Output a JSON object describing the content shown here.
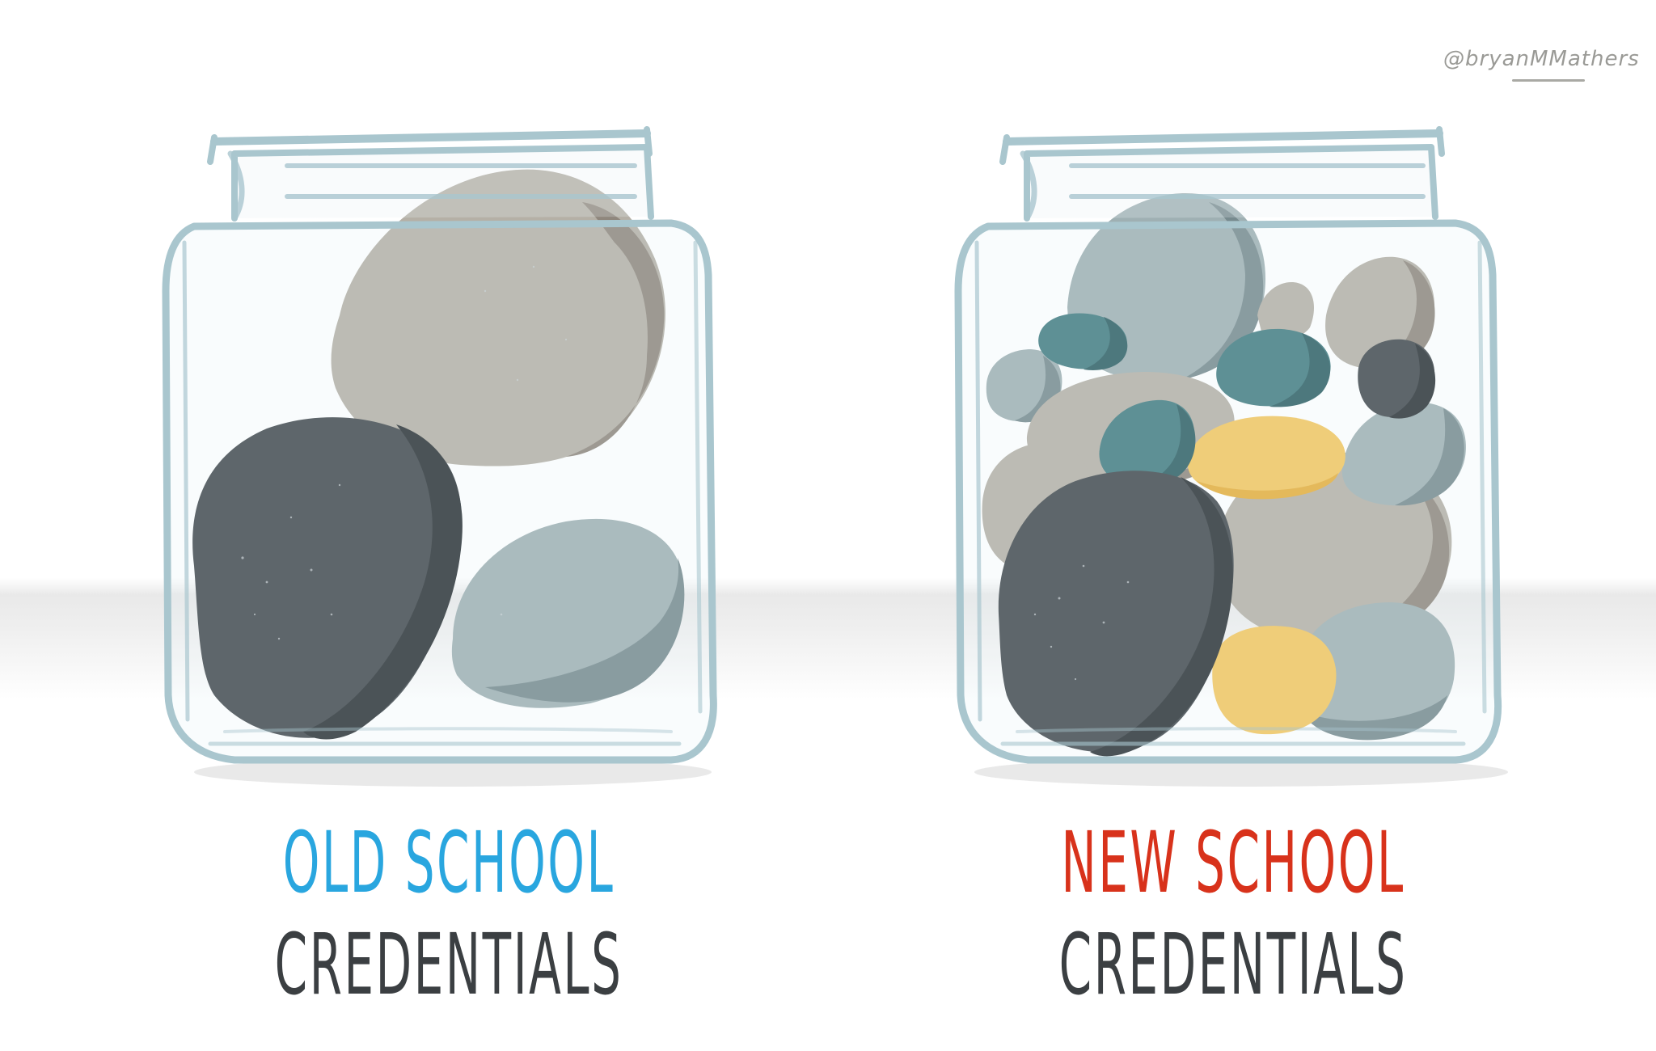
{
  "credit": "@bryanMMathers",
  "jars": [
    {
      "name": "old-school",
      "label_line1": "OLD SCHOOL",
      "label_line2": "CREDENTIALS",
      "line1_color": "#29a6df"
    },
    {
      "name": "new-school",
      "label_line1": "NEW SCHOOL",
      "label_line2": "CREDENTIALS",
      "line1_color": "#d8321b"
    }
  ],
  "label_line2_color": "#3b3f42",
  "stone_colors": {
    "taupe": "#b5b0a6",
    "taupe_shade": "#8f877d",
    "charcoal": "#43494d",
    "charcoal_shade": "#2b3135",
    "slate": "#9fb0b3",
    "slate_shade": "#778a8e",
    "teal": "#437c80",
    "teal_shade": "#2e5f63",
    "yellow": "#f3c65e",
    "yellow_shade": "#e6ae3a"
  },
  "glass_color": "#a9c6ce"
}
